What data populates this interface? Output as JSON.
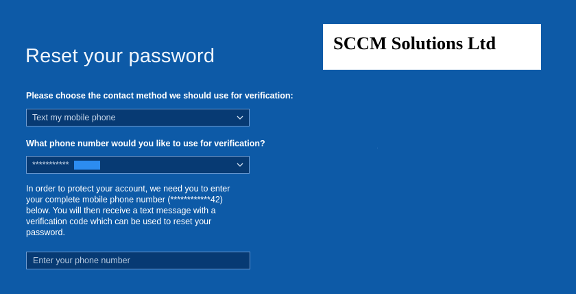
{
  "page": {
    "title": "Reset your password"
  },
  "contact_method": {
    "label": "Please choose the contact method we should use for verification:",
    "selected": "Text my mobile phone"
  },
  "phone_number": {
    "label": "What phone number would you like to use for verification?",
    "selected": "***********"
  },
  "info": {
    "text": "In order to protect your account, we need you to enter your complete mobile phone number (************42) below. You will then receive a text message with a verification code which can be used to reset your password."
  },
  "phone_input": {
    "value": "",
    "placeholder": "Enter your phone number"
  },
  "watermark": {
    "text": "SCCM Solutions Ltd"
  },
  "icons": {
    "dropdown": "chevron-down-icon"
  },
  "colors": {
    "background": "#0d5aa7",
    "field_background": "#073a73",
    "field_border": "#6f9bd0",
    "redaction": "#2c8cf0"
  }
}
